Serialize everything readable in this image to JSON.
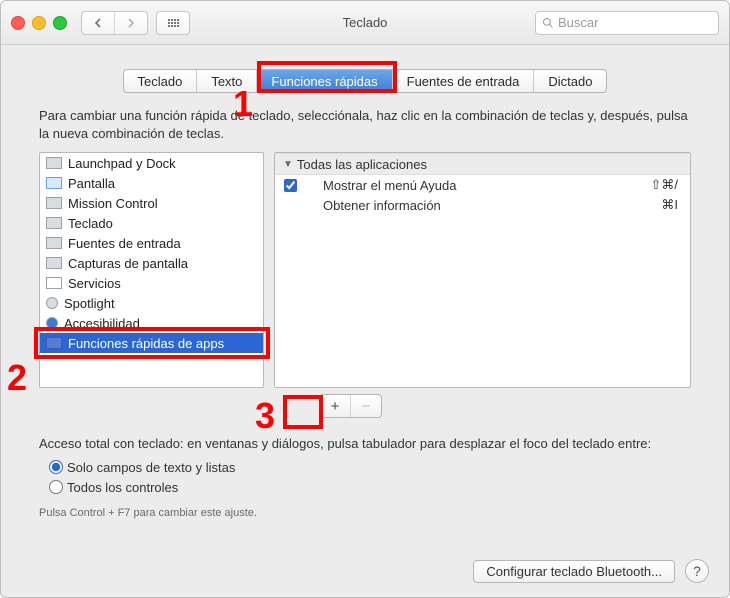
{
  "titlebar": {
    "title": "Teclado",
    "search_placeholder": "Buscar"
  },
  "tabs": {
    "items": [
      "Teclado",
      "Texto",
      "Funciones rápidas",
      "Fuentes de entrada",
      "Dictado"
    ],
    "active_index": 2
  },
  "instruction": "Para cambiar una función rápida de teclado, selecciónala, haz clic en la combinación de teclas y, después, pulsa la nueva combinación de teclas.",
  "categories": [
    {
      "label": "Launchpad y Dock"
    },
    {
      "label": "Pantalla"
    },
    {
      "label": "Mission Control"
    },
    {
      "label": "Teclado"
    },
    {
      "label": "Fuentes de entrada"
    },
    {
      "label": "Capturas de pantalla"
    },
    {
      "label": "Servicios"
    },
    {
      "label": "Spotlight"
    },
    {
      "label": "Accesibilidad"
    },
    {
      "label": "Funciones rápidas de apps",
      "selected": true
    }
  ],
  "shortcut_section": {
    "header": "Todas las aplicaciones"
  },
  "shortcuts": [
    {
      "checked": true,
      "label": "Mostrar el menú Ayuda",
      "keys": "⇧⌘/"
    },
    {
      "checked": false,
      "label": "Obtener información",
      "keys": "⌘I",
      "hide_check": true
    }
  ],
  "buttons": {
    "add": "+",
    "remove": "−"
  },
  "keyboard_access": {
    "text": "Acceso total con teclado: en ventanas y diálogos, pulsa tabulador para desplazar el foco del teclado entre:",
    "option_text_lists": "Solo campos de texto y listas",
    "option_all": "Todos los controles",
    "hint": "Pulsa Control + F7 para cambiar este ajuste."
  },
  "footer": {
    "configure": "Configurar teclado Bluetooth...",
    "help": "?"
  },
  "annotations": {
    "n1": "1",
    "n2": "2",
    "n3": "3"
  }
}
